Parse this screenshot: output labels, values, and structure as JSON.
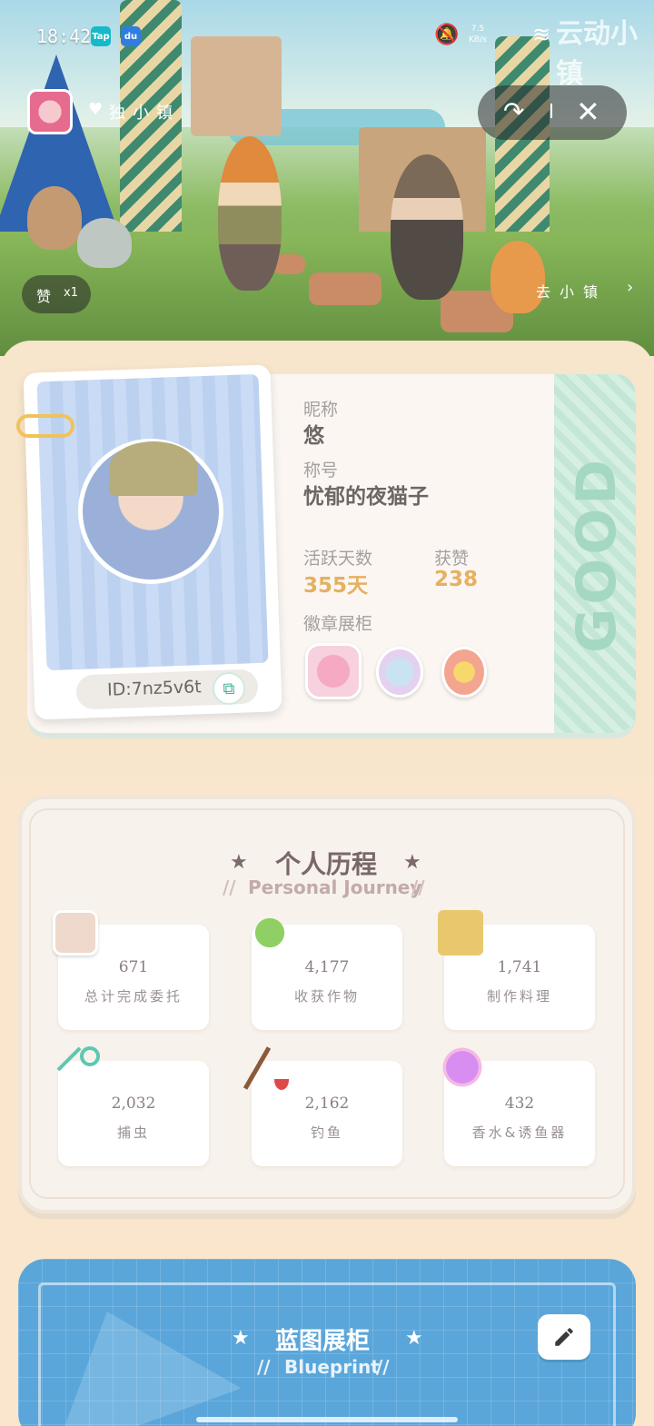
{
  "status_bar": {
    "time": "18:42",
    "app_badges": [
      "Tap",
      "du"
    ],
    "net_speed_value": "7.5",
    "net_speed_unit": "KB/s",
    "watermark": "云动小镇"
  },
  "hero": {
    "town_name": "独小镇",
    "likes_label": "赞",
    "likes_count": "x1",
    "more_link": "去小镇"
  },
  "profile": {
    "nickname_label": "昵称",
    "nickname": "悠",
    "title_label": "称号",
    "title": "忧郁的夜猫子",
    "active_days_label": "活跃天数",
    "active_days": "355天",
    "likes_label": "获赞",
    "likes": "238",
    "badges_label": "徽章展柜",
    "badges": [
      "watering-can-badge",
      "friends-badge",
      "star-bear-badge"
    ],
    "user_id": "ID:7nz5v6t",
    "stripe_text": "GOOD"
  },
  "journey": {
    "title": "个人历程",
    "subtitle": "Personal Journey",
    "stats": [
      {
        "icon": "calendar-icon",
        "value": "671",
        "label": "总计完成委托"
      },
      {
        "icon": "watering-can-icon",
        "value": "4,177",
        "label": "收获作物"
      },
      {
        "icon": "stove-icon",
        "value": "1,741",
        "label": "制作料理"
      },
      {
        "icon": "bug-net-icon",
        "value": "2,032",
        "label": "捕虫"
      },
      {
        "icon": "fishing-rod-icon",
        "value": "2,162",
        "label": "钓鱼"
      },
      {
        "icon": "perfume-bottle-icon",
        "value": "432",
        "label": "香水&诱鱼器"
      }
    ]
  },
  "blueprint": {
    "title": "蓝图展柜",
    "subtitle": "Blueprint"
  },
  "colors": {
    "page_bg": "#f9e6cd",
    "accent_gold": "#e5b061",
    "blueprint_blue": "#5aa6da",
    "mint": "#c4e6d6"
  }
}
